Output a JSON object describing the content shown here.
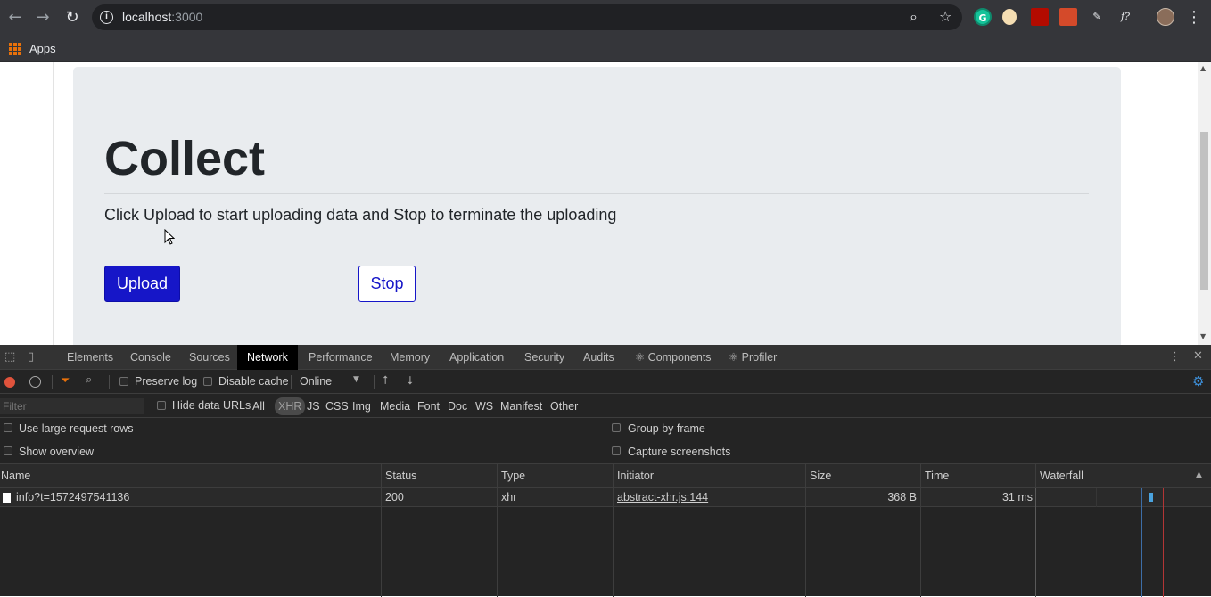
{
  "browser": {
    "url_host": "localhost",
    "url_port": ":3000",
    "bookmarks": {
      "apps_label": "Apps"
    },
    "ext_grammarly": "G",
    "ext_f": "f?"
  },
  "page": {
    "heading": "Collect",
    "lead": "Click Upload to start uploading data and Stop to terminate the uploading",
    "upload_label": "Upload",
    "stop_label": "Stop"
  },
  "devtools": {
    "tabs": [
      "Elements",
      "Console",
      "Sources",
      "Network",
      "Performance",
      "Memory",
      "Application",
      "Security",
      "Audits",
      "⚛ Components",
      "⚛ Profiler"
    ],
    "active_tab": "Network",
    "toolbar": {
      "preserve_log": "Preserve log",
      "disable_cache": "Disable cache",
      "throttling": "Online"
    },
    "filter": {
      "placeholder": "Filter",
      "hide_data_urls": "Hide data URLs",
      "types": [
        "All",
        "XHR",
        "JS",
        "CSS",
        "Img",
        "Media",
        "Font",
        "Doc",
        "WS",
        "Manifest",
        "Other"
      ],
      "active_type": "XHR"
    },
    "settings": {
      "large_rows": "Use large request rows",
      "show_overview": "Show overview",
      "group_by_frame": "Group by frame",
      "capture_screenshots": "Capture screenshots"
    },
    "columns": [
      "Name",
      "Status",
      "Type",
      "Initiator",
      "Size",
      "Time",
      "Waterfall"
    ],
    "requests": [
      {
        "name": "info?t=1572497541136",
        "status": "200",
        "type": "xhr",
        "initiator": "abstract-xhr.js:144",
        "size": "368 B",
        "time": "31 ms"
      }
    ]
  },
  "colors": {
    "primary_button": "#1616c8",
    "jumbotron_bg": "#e9ecef",
    "devtools_bg": "#242424",
    "record_red": "#e0533c",
    "waterfall_blue": "#4aa3df",
    "waterfall_red_line": "#b33535"
  }
}
